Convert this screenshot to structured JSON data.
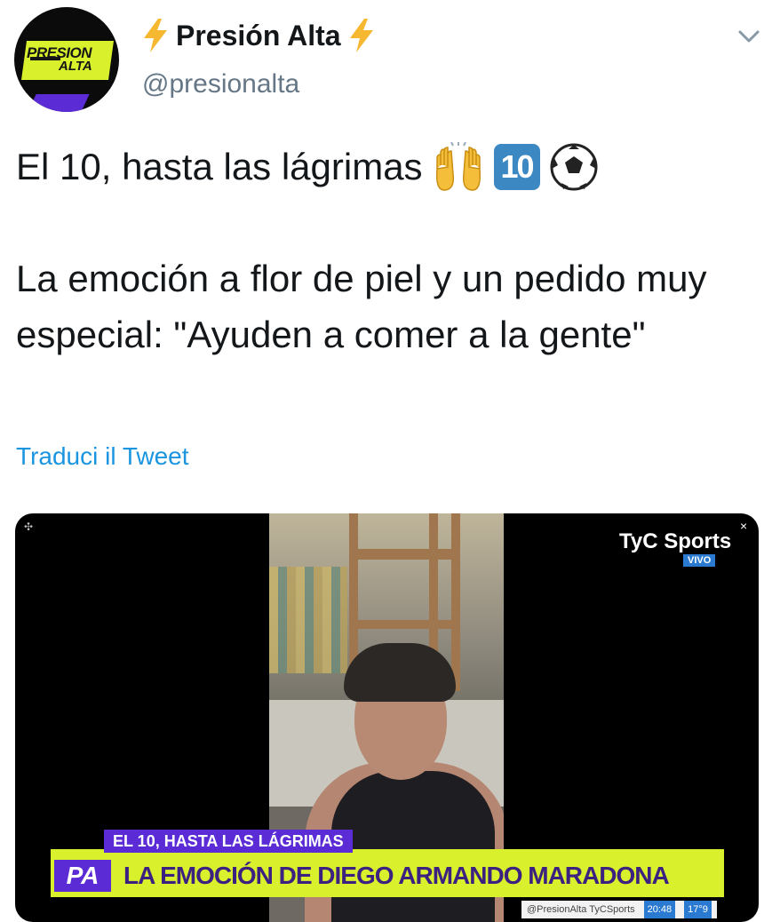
{
  "account": {
    "display_name": "Presión Alta",
    "handle": "@presionalta",
    "logo_line1": "PRESION",
    "logo_line2": "ALTA"
  },
  "tweet": {
    "line1": "El 10, hasta las lágrimas",
    "keycap_label": "10",
    "paragraph": "La emoción a flor de piel y un pedido muy especial: \"Ayuden a comer a la gente\"",
    "translate_link": "Traduci il Tweet",
    "emoji_names": [
      "raising-hands-icon",
      "keycap-10-icon",
      "soccer-ball-icon"
    ]
  },
  "media": {
    "channel": "TyC Sports",
    "live_badge": "VIVO",
    "close_symbol": "×",
    "ticker_top": "EL 10, HASTA LAS LÁGRIMAS",
    "ticker_badge": "PA",
    "ticker_main": "LA EMOCIÓN DE DIEGO ARMANDO MARADONA",
    "ticker_footer": "@PresionAlta TyCSports",
    "ticker_time": "20:48",
    "ticker_extra": "17°9"
  },
  "colors": {
    "link": "#1b95e0",
    "ticker_green": "#d9f02c",
    "ticker_purple": "#5b2bd6",
    "keycap_blue": "#3b88c3",
    "bolt": "#f6b831"
  }
}
